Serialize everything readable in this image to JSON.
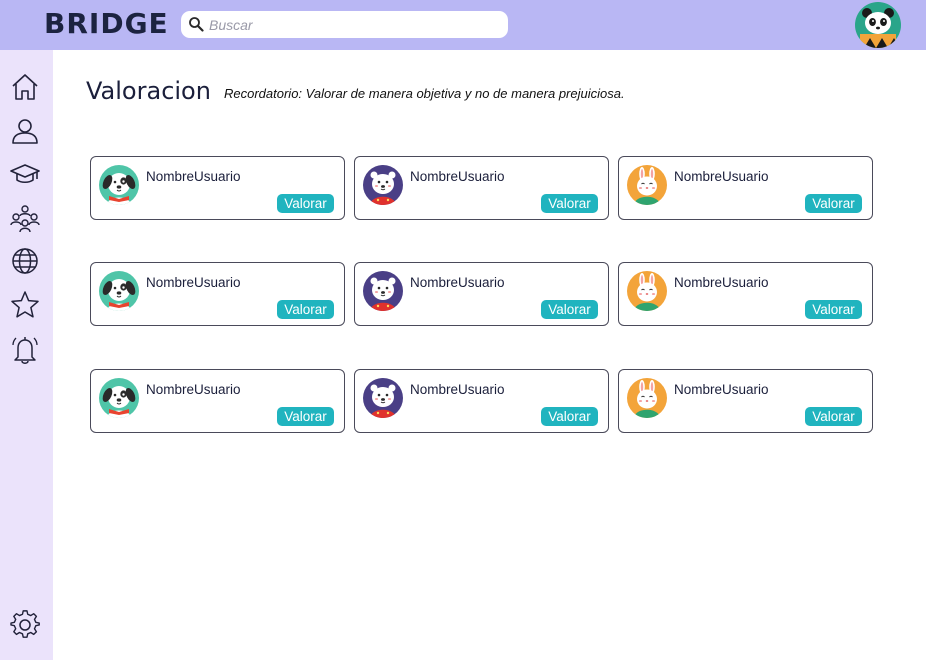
{
  "app": {
    "logo_text": "BRIDGE"
  },
  "search": {
    "placeholder": "Buscar",
    "value": ""
  },
  "header": {
    "avatar_icon": "panda-avatar-icon"
  },
  "sidebar": {
    "items": [
      {
        "name": "home",
        "icon": "home-icon"
      },
      {
        "name": "profile",
        "icon": "user-icon"
      },
      {
        "name": "courses",
        "icon": "graduation-cap-icon"
      },
      {
        "name": "community",
        "icon": "group-icon"
      },
      {
        "name": "explore",
        "icon": "globe-icon"
      },
      {
        "name": "favorites",
        "icon": "star-icon"
      },
      {
        "name": "notifications",
        "icon": "bell-icon"
      }
    ],
    "settings_icon": "gear-icon"
  },
  "main": {
    "title": "Valoracion",
    "reminder": "Recordatorio: Valorar de manera objetiva y no de manera prejuiciosa.",
    "users": [
      {
        "name": "NombreUsuario",
        "button": "Valorar",
        "avatar": "dog"
      },
      {
        "name": "NombreUsuario",
        "button": "Valorar",
        "avatar": "bear"
      },
      {
        "name": "NombreUsuario",
        "button": "Valorar",
        "avatar": "bunny"
      },
      {
        "name": "NombreUsuario",
        "button": "Valorar",
        "avatar": "dog"
      },
      {
        "name": "NombreUsuario",
        "button": "Valorar",
        "avatar": "bear"
      },
      {
        "name": "NombreUsuario",
        "button": "Valorar",
        "avatar": "bunny"
      },
      {
        "name": "NombreUsuario",
        "button": "Valorar",
        "avatar": "dog"
      },
      {
        "name": "NombreUsuario",
        "button": "Valorar",
        "avatar": "bear"
      },
      {
        "name": "NombreUsuario",
        "button": "Valorar",
        "avatar": "bunny"
      }
    ]
  },
  "colors": {
    "header_bg": "#b9b7f4",
    "sidebar_bg": "#ebe3fb",
    "button_bg": "#20b4bf",
    "dog_bg": "#4fc5a8",
    "bear_bg": "#4a3f86",
    "bunny_bg": "#f3a43a"
  }
}
